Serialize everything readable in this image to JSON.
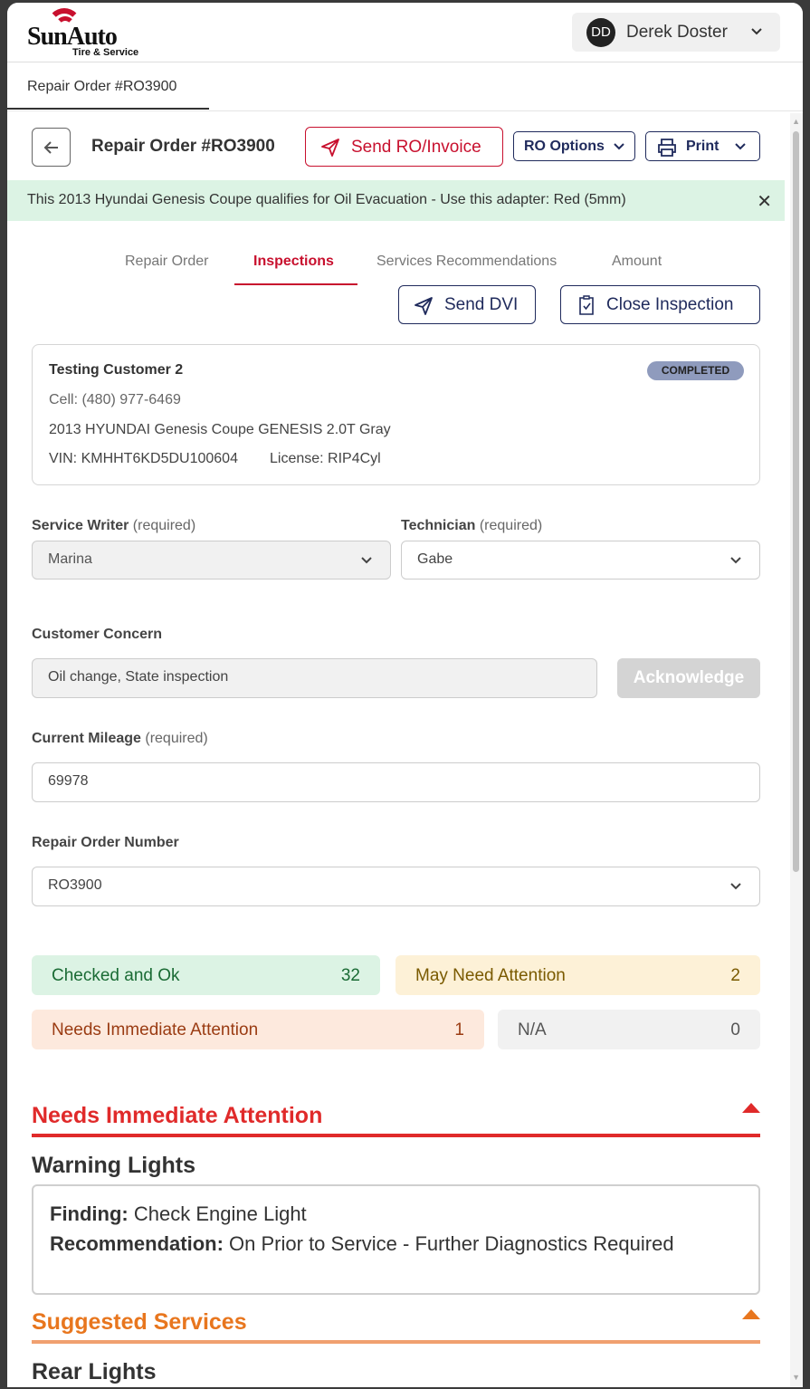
{
  "brand": {
    "name": "SunAuto",
    "sub": "Tire & Service"
  },
  "user": {
    "initials": "DD",
    "name": "Derek Doster"
  },
  "page_tab": "Repair Order #RO3900",
  "toolbar": {
    "title": "Repair Order #RO3900",
    "send_ro": "Send RO/Invoice",
    "ro_options": "RO Options",
    "print": "Print"
  },
  "alert": {
    "text": "This 2013 Hyundai Genesis Coupe qualifies for Oil Evacuation - Use this adapter: Red (5mm)"
  },
  "tabs": [
    {
      "label": "Repair Order"
    },
    {
      "label": "Inspections"
    },
    {
      "label": "Services Recommendations"
    },
    {
      "label": "Amount"
    }
  ],
  "actions": {
    "send_dvi": "Send DVI",
    "close_inspection": "Close Inspection"
  },
  "customer": {
    "name": "Testing Customer 2",
    "status": "COMPLETED",
    "phone": "Cell: (480) 977-6469",
    "vehicle": "2013 HYUNDAI Genesis Coupe GENESIS 2.0T Gray",
    "vin": "VIN: KMHHT6KD5DU100604",
    "license": "License: RIP4Cyl"
  },
  "form": {
    "service_writer": {
      "label": "Service Writer",
      "req": "(required)",
      "value": "Marina"
    },
    "technician": {
      "label": "Technician",
      "req": "(required)",
      "value": "Gabe"
    },
    "concern": {
      "label": "Customer Concern",
      "value": "Oil change,  State inspection",
      "ack": "Acknowledge"
    },
    "mileage": {
      "label": "Current Mileage",
      "req": "(required)",
      "value": "69978"
    },
    "ro_number": {
      "label": "Repair Order Number",
      "value": "RO3900"
    }
  },
  "summary": {
    "ok": {
      "label": "Checked and Ok",
      "count": "32"
    },
    "may": {
      "label": "May Need Attention",
      "count": "2"
    },
    "need": {
      "label": "Needs Immediate Attention",
      "count": "1"
    },
    "na": {
      "label": "N/A",
      "count": "0"
    }
  },
  "sections": {
    "immediate": {
      "title": "Needs Immediate Attention",
      "color": "#e02a2a",
      "item": "Warning Lights",
      "finding_label": "Finding:",
      "finding": "Check Engine Light",
      "rec_label": "Recommendation:",
      "recommendation": "On Prior to Service - Further Diagnostics Required"
    },
    "suggested": {
      "title": "Suggested Services",
      "color": "#e8761e",
      "item": "Rear Lights"
    }
  }
}
